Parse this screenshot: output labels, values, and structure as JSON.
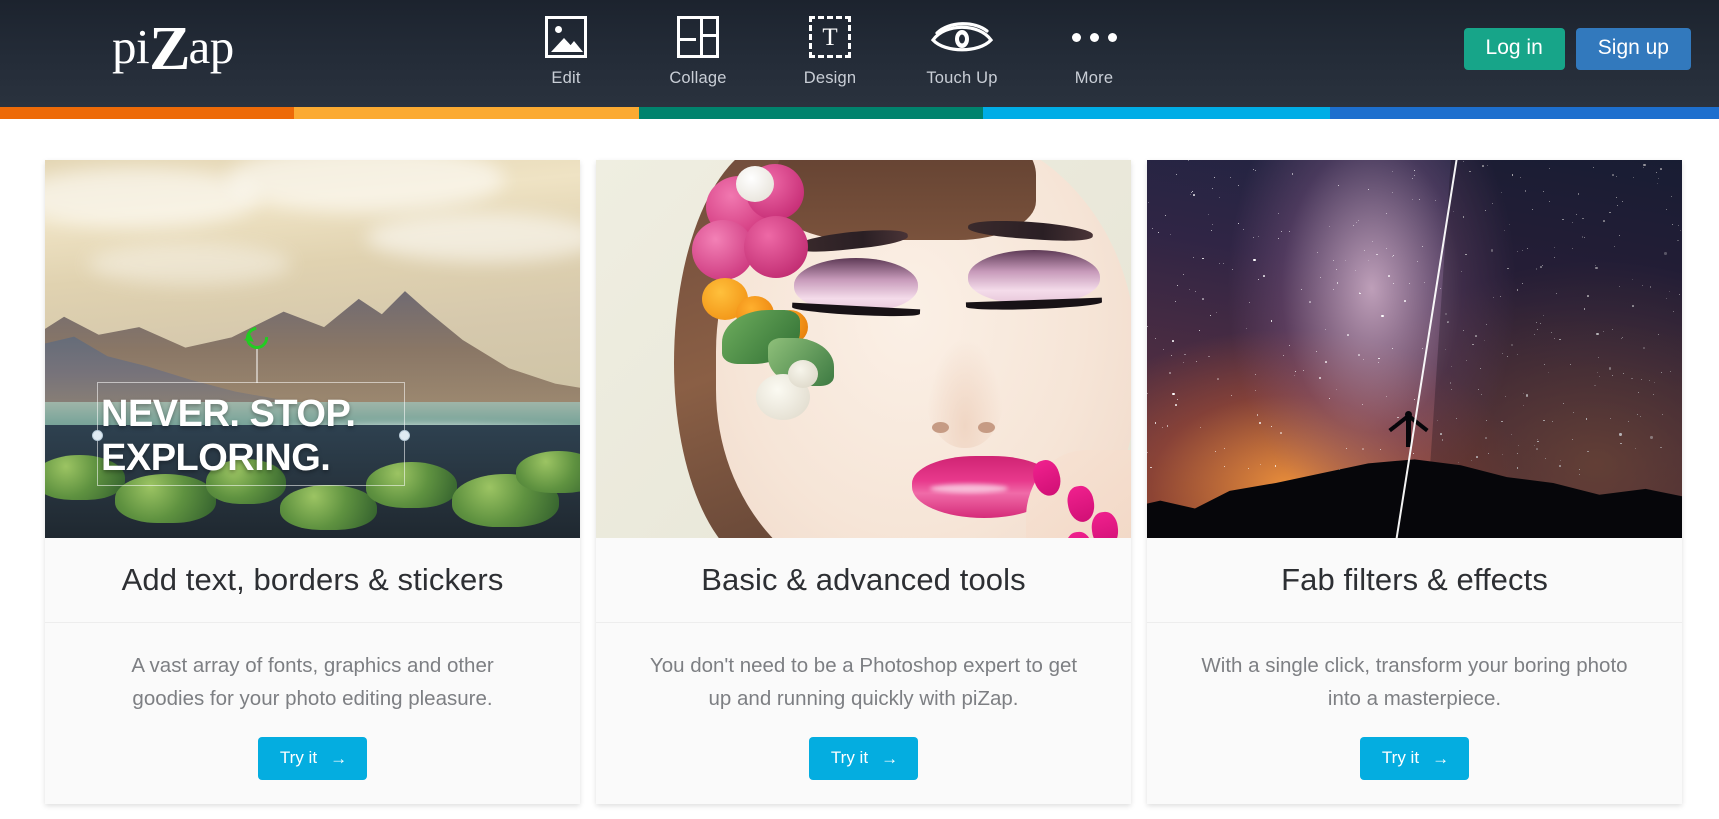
{
  "site": {
    "logo_text_pre": "pi",
    "logo_text_z": "Z",
    "logo_text_post": "ap"
  },
  "header": {
    "nav": [
      {
        "label": "Edit",
        "icon": "image-icon"
      },
      {
        "label": "Collage",
        "icon": "grid-icon"
      },
      {
        "label": "Design",
        "icon": "text-box-icon",
        "glyph": "T"
      },
      {
        "label": "Touch Up",
        "icon": "eye-icon"
      },
      {
        "label": "More",
        "icon": "ellipsis-icon"
      }
    ],
    "auth": {
      "login_label": "Log in",
      "login_color": "#17a589",
      "signup_label": "Sign up",
      "signup_color": "#3279bd"
    },
    "background_color": "#242c38"
  },
  "color_strip": [
    {
      "name": "orange",
      "color": "#ed6a08",
      "width_pct": 17.1
    },
    {
      "name": "amber",
      "color": "#fbaa32",
      "width_pct": 20.1
    },
    {
      "name": "teal-green",
      "color": "#00836d",
      "width_pct": 20.0
    },
    {
      "name": "cyan",
      "color": "#00ade6",
      "width_pct": 20.2
    },
    {
      "name": "blue",
      "color": "#1d6fce",
      "width_pct": 22.6
    }
  ],
  "cards": [
    {
      "id": "add-text-borders-stickers",
      "title": "Add text, borders & stickers",
      "description": "A vast array of fonts, graphics and other goodies for your photo editing pleasure.",
      "cta_label": "Try it",
      "cta_arrow": "→",
      "image_alt": "mountain-landscape-photo",
      "image_overlay_text": "NEVER. STOP.\nEXPLORING."
    },
    {
      "id": "basic-advanced-tools",
      "title": "Basic & advanced tools",
      "description": "You don't need to be a Photoshop expert to get up and running quickly with piZap.",
      "cta_label": "Try it",
      "cta_arrow": "→",
      "image_alt": "beauty-portrait-photo",
      "image_overlay_text": ""
    },
    {
      "id": "fab-filters-effects",
      "title": "Fab filters & effects",
      "description": "With a single click, transform your boring photo into a masterpiece.",
      "cta_label": "Try it",
      "cta_arrow": "→",
      "image_alt": "milky-way-night-sky-photo",
      "image_overlay_text": ""
    }
  ],
  "theme": {
    "cta_color": "#04ade0",
    "page_background": "#ffffff",
    "card_background": "#fafafa",
    "title_color": "#2d2f33",
    "body_text_color": "#7d7f83"
  }
}
